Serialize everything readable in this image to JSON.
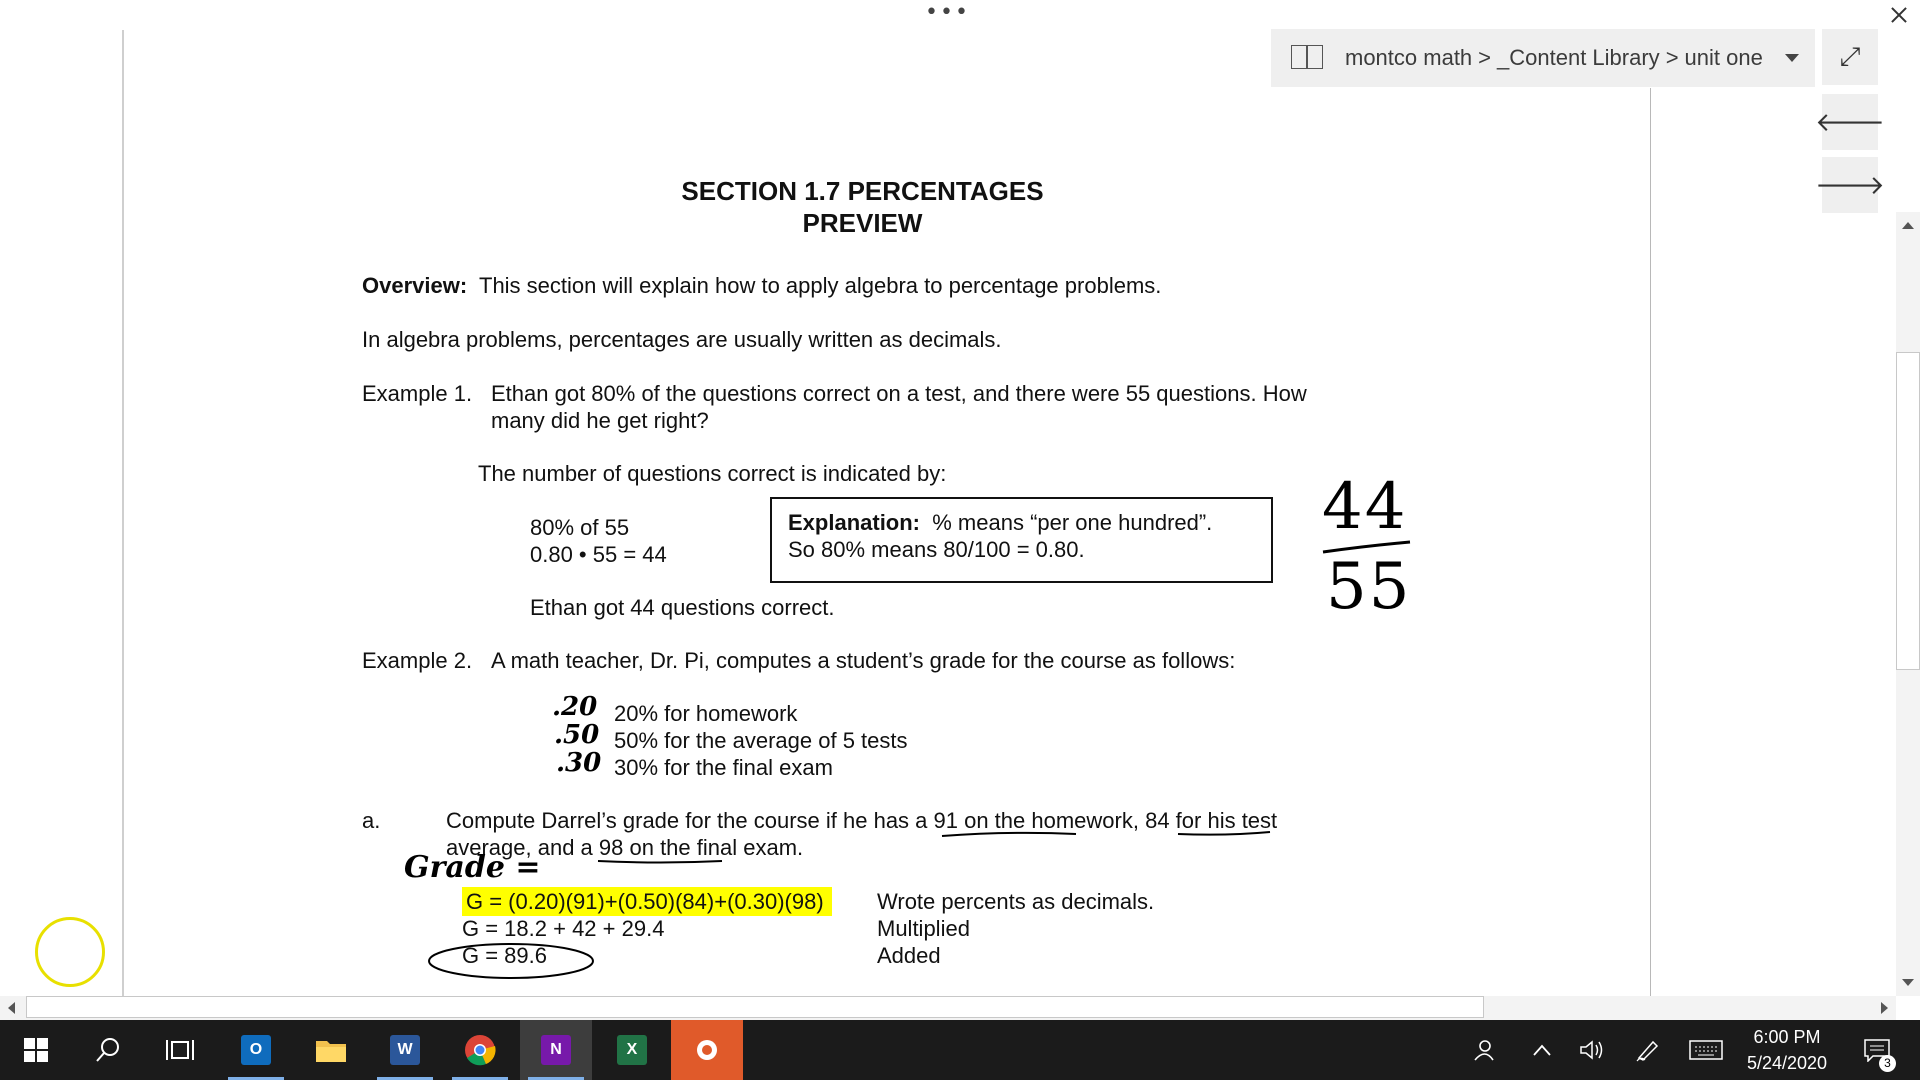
{
  "window": {
    "more_dots": "•••",
    "breadcrumb": {
      "notebook": "montco math",
      "section_group": "_Content Library",
      "section": "unit one",
      "separator": ">"
    }
  },
  "document": {
    "title_line1": "SECTION 1.7 PERCENTAGES",
    "title_line2": "PREVIEW",
    "overview_label": "Overview:",
    "overview_text": "This section will explain how to apply algebra to percentage problems.",
    "intro": "In algebra problems, percentages are usually written as decimals.",
    "example1": {
      "label": "Example 1.",
      "line1": "Ethan got 80% of the questions correct on a test, and there were 55 questions. How",
      "line2": "many did he get right?",
      "indicated": "The number of questions correct is indicated by:",
      "calc1": "80% of 55",
      "calc2": "0.80 • 55 = 44",
      "explanation_label": "Explanation:",
      "explanation_line1": "% means “per one hundred”.",
      "explanation_line2": "So 80% means 80/100 = 0.80.",
      "result": "Ethan got 44 questions correct."
    },
    "example2": {
      "label": "Example 2.",
      "text": "A math teacher, Dr. Pi, computes a student’s grade for the course as follows:",
      "items": [
        {
          "note": ".20",
          "text": "20% for homework"
        },
        {
          "note": ".50",
          "text": "50% for the average of 5 tests"
        },
        {
          "note": ".30",
          "text": "30% for the final exam"
        }
      ]
    },
    "part_a": {
      "label": "a.",
      "line1_pre": "Compute Darrel’s grade for the course if he has a ",
      "line1_u1": "91 on the homework",
      "line1_mid": ", ",
      "line1_u2": "84 for his test",
      "line2_pre": "average, and a ",
      "line2_u": "98 on the final exam",
      "line2_post": ".",
      "grade_note": "Grade =",
      "eq1": "G = (0.20)(91)+(0.50)(84)+(0.30)(98)",
      "eq2": "G = 18.2 + 42 + 29.4",
      "eq3": "G = 89.6",
      "desc1": "Wrote percents as decimals.",
      "desc2": "Multiplied",
      "desc3": "Added"
    },
    "handwritten_fraction": {
      "numerator": "44",
      "denominator": "55"
    }
  },
  "taskbar": {
    "apps": [
      {
        "name": "Outlook",
        "letter": "O",
        "color": "#0f6cbd"
      },
      {
        "name": "File Explorer",
        "letter": "",
        "color": "#f2c14e"
      },
      {
        "name": "Word",
        "letter": "W",
        "color": "#2b579a"
      },
      {
        "name": "Chrome",
        "letter": "",
        "color": "#db4437"
      },
      {
        "name": "OneNote",
        "letter": "N",
        "color": "#7719aa"
      },
      {
        "name": "Excel",
        "letter": "X",
        "color": "#217346"
      },
      {
        "name": "Recorder",
        "letter": "",
        "color": "#e05a2a"
      }
    ],
    "time": "6:00 PM",
    "date": "5/24/2020",
    "notification_count": "3"
  },
  "colors": {
    "highlight": "#ffff00",
    "cursor_ring": "#e8e000",
    "taskbar": "#1b1b1b"
  }
}
